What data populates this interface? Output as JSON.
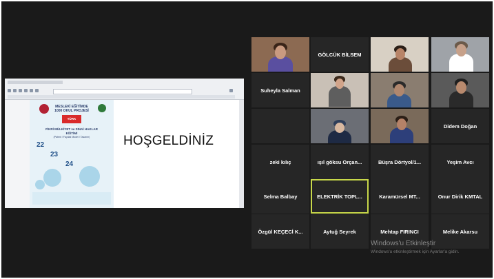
{
  "shared_screen": {
    "welcome_text": "HOŞGELDİNİZ",
    "pdf": {
      "line1": "MESLEKİ EĞİTİMDE",
      "line2": "1000 OKUL PROJESİ",
      "badge": "TÜRK PATENT",
      "course_line1": "FİKRİ MÜLKİYET ve SINAİ HAKLAR",
      "course_line2": "EĞİTİMİ",
      "course_line3": "(Patent / Faydalı Model / Tasarım)",
      "date1": "22",
      "date2": "23",
      "date3": "24"
    }
  },
  "participants": [
    {
      "id": "p1",
      "name": "",
      "video": true
    },
    {
      "id": "p2",
      "name": "GÖLCÜK BİLSEM",
      "video": false
    },
    {
      "id": "p3",
      "name": "",
      "video": true
    },
    {
      "id": "p4",
      "name": "",
      "video": true
    },
    {
      "id": "p5",
      "name": "Suheyla Salman",
      "video": false
    },
    {
      "id": "p6",
      "name": "",
      "video": true
    },
    {
      "id": "p7",
      "name": "",
      "video": true
    },
    {
      "id": "p8",
      "name": "",
      "video": true
    },
    {
      "id": "p9",
      "name": "",
      "video": false
    },
    {
      "id": "p10",
      "name": "",
      "video": true
    },
    {
      "id": "p11",
      "name": "",
      "video": true
    },
    {
      "id": "p12",
      "name": "Didem Doğan",
      "video": false
    },
    {
      "id": "p13",
      "name": "zeki kılıç",
      "video": false
    },
    {
      "id": "p14",
      "name": "ışıl göksu Orçan...",
      "video": false
    },
    {
      "id": "p15",
      "name": "Büşra Dörtyol/1...",
      "video": false
    },
    {
      "id": "p16",
      "name": "Yeşim Avcı",
      "video": false
    },
    {
      "id": "p17",
      "name": "Selma Balbay",
      "video": false
    },
    {
      "id": "p18",
      "name": "ELEKTRİK TOPL...",
      "video": false,
      "active_speaker": true
    },
    {
      "id": "p19",
      "name": "Karamürsel MT...",
      "video": false
    },
    {
      "id": "p20",
      "name": "Onur Dirik KMTAL",
      "video": false
    },
    {
      "id": "p21",
      "name": "Özgül KEÇECİ K...",
      "video": false
    },
    {
      "id": "p22",
      "name": "Aytuğ Seyrek",
      "video": false
    },
    {
      "id": "p23",
      "name": "Mehtap FIRINCI",
      "video": false
    },
    {
      "id": "p24",
      "name": "Melike Akarsu",
      "video": false
    }
  ],
  "watermark": {
    "title": "Windows'u Etkinleştir",
    "subtitle": "Windows'u etkinleştirmek için Ayarlar'a gidin."
  }
}
